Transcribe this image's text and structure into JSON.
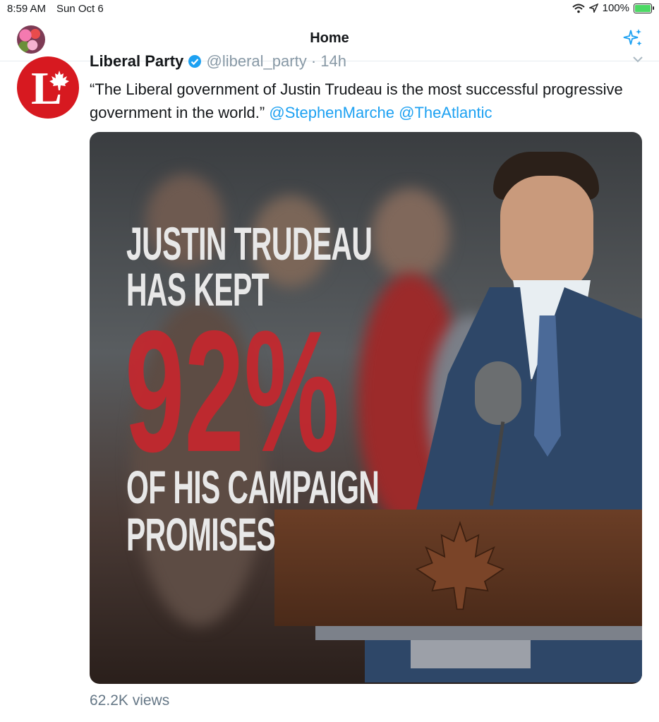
{
  "status_bar": {
    "time": "8:59 AM",
    "date": "Sun Oct 6",
    "battery": "100%",
    "battery_level": 1.0
  },
  "nav": {
    "title": "Home"
  },
  "tweet": {
    "author_name": "Liberal Party",
    "handle": "@liberal_party",
    "separator": "·",
    "time": "14h",
    "avatar_letter": "L",
    "text_quote": "“The Liberal government of Justin Trudeau is the most successful progressive government in the world.”",
    "mentions": [
      "@StephenMarche",
      "@TheAtlantic"
    ],
    "media": {
      "line1": "JUSTIN TRUDEAU",
      "line2": "HAS KEPT",
      "percent": "92%",
      "line3": "OF HIS CAMPAIGN",
      "line4": "PROMISES"
    },
    "views": "62.2K views"
  },
  "colors": {
    "accent": "#1da1f2",
    "brand_red": "#d71920",
    "muted": "#657786"
  }
}
